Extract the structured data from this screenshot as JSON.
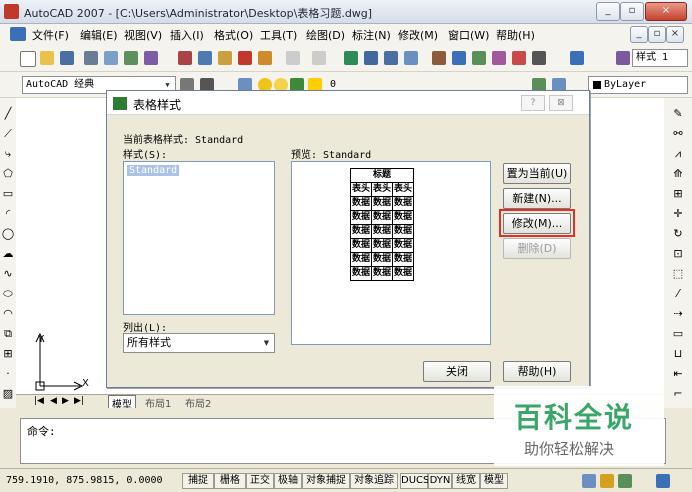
{
  "app": {
    "title": "AutoCAD 2007 - [C:\\Users\\Administrator\\Desktop\\表格习题.dwg]",
    "win_min": "_",
    "win_max": "▫",
    "win_close": "×",
    "doc_min": "_",
    "doc_restore": "▫",
    "doc_close": "×"
  },
  "menu": {
    "items": [
      "文件(F)",
      "编辑(E)",
      "视图(V)",
      "插入(I)",
      "格式(O)",
      "工具(T)",
      "绘图(D)",
      "标注(N)",
      "修改(M)",
      "窗口(W)",
      "帮助(H)"
    ]
  },
  "toolbar": {
    "text_style": "样式 1",
    "workspace": "AutoCAD 经典",
    "layer": "0",
    "color": "ByLayer"
  },
  "drawing": {
    "axis_y": "Y",
    "axis_x": "X",
    "tabs": [
      "模型",
      "布局1",
      "布局2"
    ]
  },
  "dialog": {
    "title": "表格样式",
    "help": "?",
    "close": "⊠",
    "current_style_label": "当前表格样式: Standard",
    "styles_label": "样式(S):",
    "styles": [
      "Standard"
    ],
    "list_label": "列出(L):",
    "list_value": "所有样式",
    "preview_label": "预览: Standard",
    "preview": {
      "title": "标题",
      "header": "表头",
      "cell": "数据"
    },
    "btn_set_current": "置为当前(U)",
    "btn_new": "新建(N)...",
    "btn_modify": "修改(M)...",
    "btn_delete": "删除(D)",
    "btn_close": "关闭",
    "btn_help": "帮助(H)"
  },
  "command": {
    "prompt": "命令:"
  },
  "status": {
    "coords": "759.1910, 875.9815, 0.0000",
    "toggles": [
      "捕捉",
      "栅格",
      "正交",
      "极轴",
      "对象捕捉",
      "对象追踪",
      "DUCS",
      "DYN",
      "线宽",
      "模型"
    ]
  },
  "watermark": {
    "line1": "百科全说",
    "line2": "助你轻松解决"
  }
}
